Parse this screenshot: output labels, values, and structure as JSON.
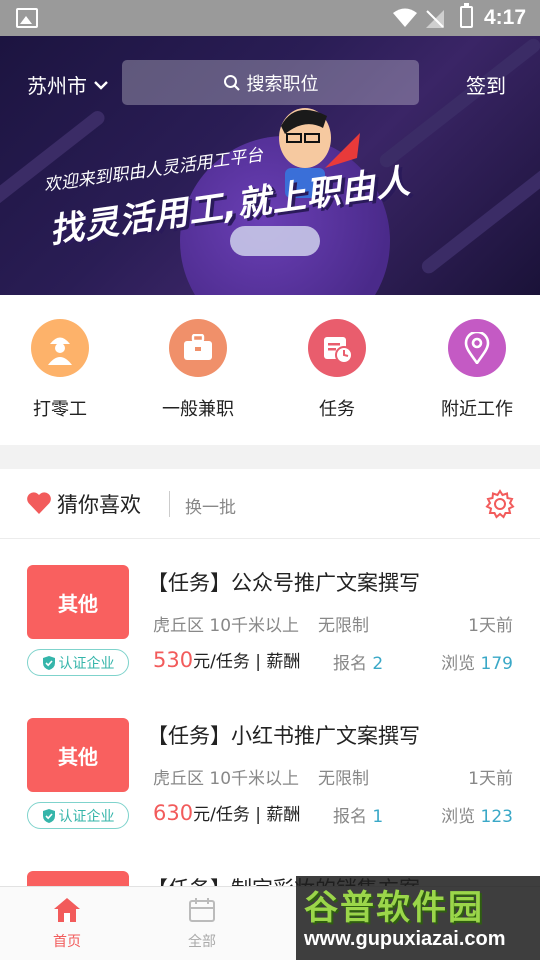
{
  "status_bar": {
    "time": "4:17"
  },
  "header": {
    "city": "苏州市",
    "search_placeholder": "搜索职位",
    "signin": "签到"
  },
  "banner": {
    "line1": "欢迎来到职由人灵活用工平台",
    "line2": "找灵活用工,就上职由人"
  },
  "categories": [
    {
      "label": "打零工",
      "icon": "worker-icon",
      "color": "#fdb26a"
    },
    {
      "label": "一般兼职",
      "icon": "briefcase-icon",
      "color": "#f0906a"
    },
    {
      "label": "任务",
      "icon": "task-calendar-icon",
      "color": "#e95d6d"
    },
    {
      "label": "附近工作",
      "icon": "location-pin-icon",
      "color": "#c45ac4"
    }
  ],
  "guess": {
    "title": "猜你喜欢",
    "refresh": "换一批"
  },
  "jobs": [
    {
      "tag": "其他",
      "cert": "认证企业",
      "title": "【任务】公众号推广文案撰写",
      "location": "虎丘区 10千米以上",
      "limit": "无限制",
      "time": "1天前",
      "price": "530",
      "price_unit": "元/任务 | 薪酬",
      "enroll_label": "报名",
      "enroll_count": "2",
      "views_label": "浏览",
      "views_count": "179"
    },
    {
      "tag": "其他",
      "cert": "认证企业",
      "title": "【任务】小红书推广文案撰写",
      "location": "虎丘区 10千米以上",
      "limit": "无限制",
      "time": "1天前",
      "price": "630",
      "price_unit": "元/任务 | 薪酬",
      "enroll_label": "报名",
      "enroll_count": "1",
      "views_label": "浏览",
      "views_count": "123"
    },
    {
      "tag": "",
      "title": "【任务】制定彩妆的销售方案"
    }
  ],
  "tabbar": {
    "tabs": [
      {
        "label": "首页",
        "icon": "home-icon",
        "active": true
      },
      {
        "label": "全部",
        "icon": "list-icon",
        "active": false
      }
    ]
  },
  "watermark": {
    "line1": "谷普软件园",
    "line2": "www.gupuxiazai.com"
  },
  "colors": {
    "accent": "#f9605f",
    "teal": "#35b5aa",
    "price": "#f25b5b"
  }
}
